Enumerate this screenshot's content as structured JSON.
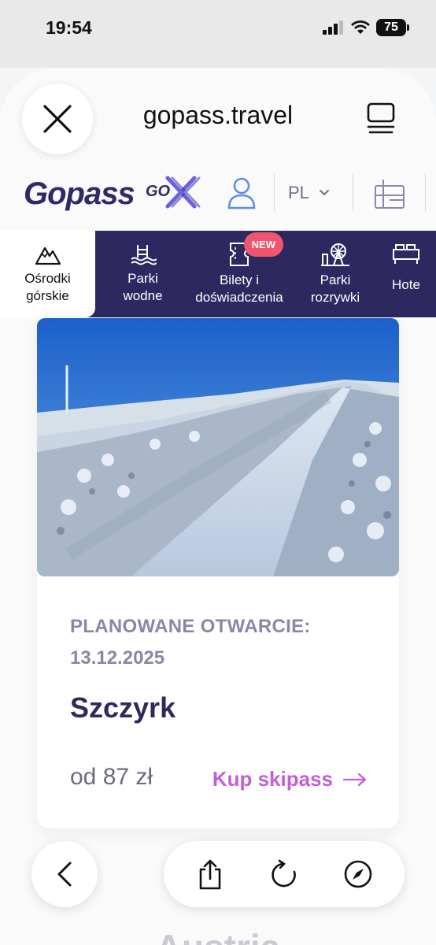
{
  "status_bar": {
    "time": "19:54",
    "battery": "75"
  },
  "browser": {
    "url": "gopass.travel"
  },
  "site_header": {
    "logo": "Gopass",
    "language": "PL"
  },
  "categories": [
    {
      "line1": "Ośrodki",
      "line2": "górskie",
      "active": true
    },
    {
      "line1": "Parki",
      "line2": "wodne"
    },
    {
      "line1": "Bilety i",
      "line2": "doświadczenia",
      "badge": "NEW"
    },
    {
      "line1": "Parki",
      "line2": "rozrywki"
    },
    {
      "line1": "Hote",
      "line2": ""
    }
  ],
  "card": {
    "opening_label": "PLANOWANE OTWARCIE:",
    "opening_date": "13.12.2025",
    "resort_name": "Szczyrk",
    "price": "od 87 zł",
    "cta": "Kup skipass"
  },
  "next_section_title": "Austria",
  "colors": {
    "nav_bg": "#2d2960",
    "brand": "#2f2a67",
    "accent": "#c45ed8",
    "badge": "#f0556e"
  }
}
